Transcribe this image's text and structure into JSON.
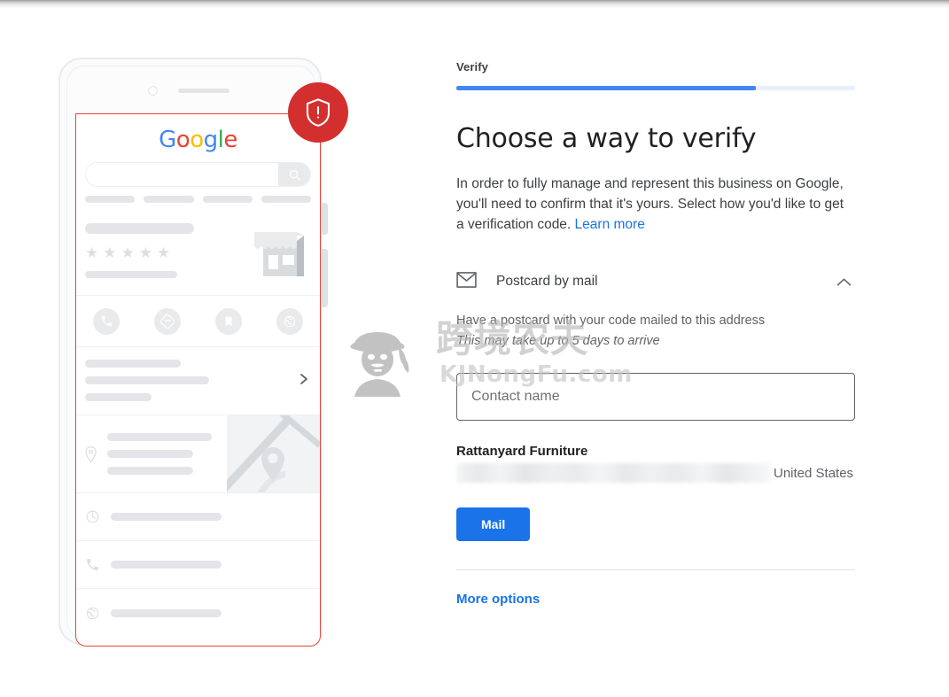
{
  "progress": {
    "step_label": "Verify",
    "percent": 75
  },
  "heading": "Choose a way to verify",
  "description": {
    "text": "In order to fully manage and represent this business on Google, you'll need to confirm that it's yours. Select how you'd like to get a verification code. ",
    "link_label": "Learn more"
  },
  "option": {
    "icon": "envelope-icon",
    "title": "Postcard by mail",
    "collapse_icon": "chevron-up-icon",
    "description": "Have a postcard with your code mailed to this address",
    "note": "This may take up to 5 days to arrive"
  },
  "contact": {
    "placeholder": "Contact name",
    "value": ""
  },
  "business": {
    "name": "Rattanyard Furniture",
    "address_redacted": "",
    "country": "United States"
  },
  "actions": {
    "submit_label": "Mail",
    "more_options_label": "More options"
  },
  "colors": {
    "accent_blue": "#1a73e8",
    "progress_blue": "#4285f4",
    "progress_track": "#e8eff9",
    "alert_red": "#d32f2f",
    "screen_outline_red": "#ea4335"
  },
  "phone_preview": {
    "logo": {
      "letters": [
        {
          "char": "G",
          "color": "#4285f4"
        },
        {
          "char": "o",
          "color": "#ea4335"
        },
        {
          "char": "o",
          "color": "#fbbc05"
        },
        {
          "char": "g",
          "color": "#4285f4"
        },
        {
          "char": "l",
          "color": "#34a853"
        },
        {
          "char": "e",
          "color": "#ea4335"
        }
      ]
    },
    "search_icon": "search-icon",
    "rating_stars": 5,
    "action_icons": [
      "phone-icon",
      "directions-icon",
      "bookmark-icon",
      "website-icon"
    ],
    "detail_icons": [
      "clock-icon",
      "phone-icon",
      "globe-icon"
    ],
    "location_icon": "map-pin-icon",
    "chevron_icon": "chevron-right-icon",
    "badge_icon": "shield-alert-icon"
  },
  "watermark": {
    "text_cn": "跨境农夫",
    "text_en": "KJNongFu.com",
    "mark": "farmer-logo-icon"
  }
}
